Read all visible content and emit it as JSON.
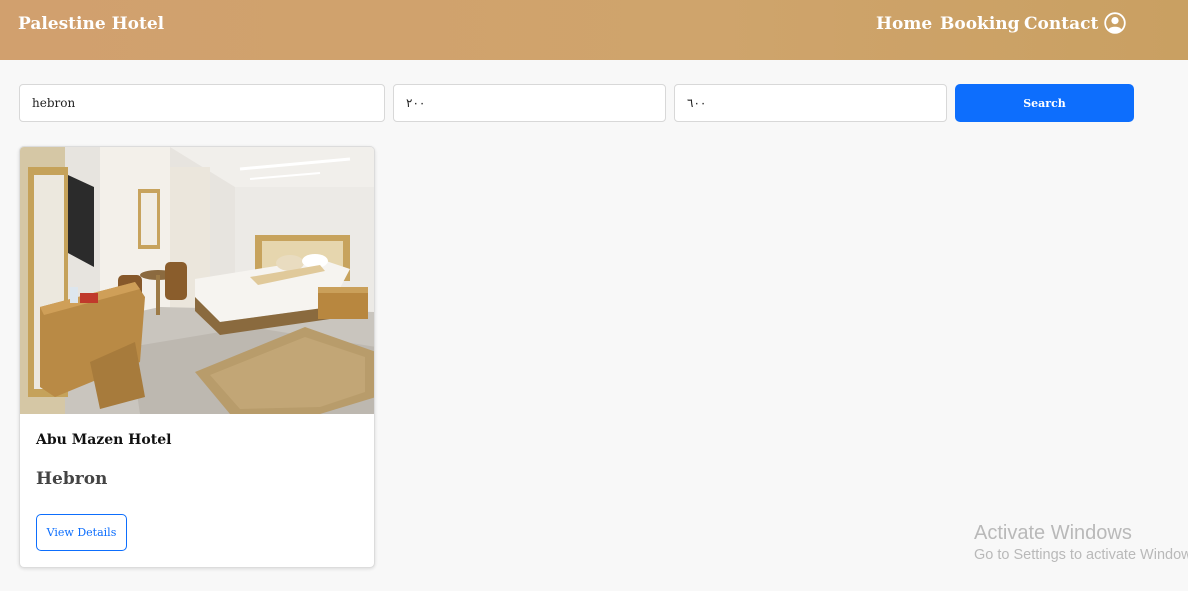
{
  "navbar": {
    "brand": "Palestine Hotel",
    "links": [
      {
        "label": "Home"
      },
      {
        "label": "Booking"
      },
      {
        "label": "Contact"
      }
    ],
    "account_icon": "user-circle-icon"
  },
  "search": {
    "city_value": "hebron",
    "min_price_value": "٢٠٠",
    "max_price_value": "٦٠٠",
    "button_label": "Search"
  },
  "results": [
    {
      "photo": "hotel-room-photo",
      "name": "Abu Mazen Hotel",
      "city": "Hebron",
      "button_label": "View Details"
    }
  ],
  "watermark": {
    "title": "Activate Windows",
    "subtitle": "Go to Settings to activate Windows."
  },
  "colors": {
    "navbar": "#cfa46c",
    "primary": "#0d6efd",
    "background": "#f8f8f8"
  }
}
